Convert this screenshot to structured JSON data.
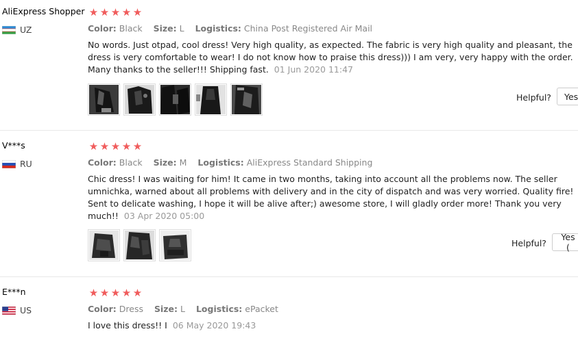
{
  "labels": {
    "color": "Color:",
    "size": "Size:",
    "logistics": "Logistics:",
    "helpful": "Helpful?",
    "yes": "Yes"
  },
  "reviews": [
    {
      "user": "AliExpress Shopper",
      "country": "UZ",
      "stars": 5,
      "color": "Black",
      "size": "L",
      "logistics": "China Post Registered Air Mail",
      "text": "No words. Just otpad, cool dress! Very high quality, as expected. The fabric is very high quality and pleasant, the dress is very comfortable to wear! I do not know how to praise this dress))) I am very, very happy with the order. Many thanks to the seller!!! Shipping fast.",
      "date": "01 Jun 2020 11:47",
      "photos": [
        "review-photo",
        "review-photo",
        "review-photo",
        "review-photo",
        "review-photo"
      ],
      "yes_label": "Yes"
    },
    {
      "user": "V***s",
      "country": "RU",
      "stars": 5,
      "color": "Black",
      "size": "M",
      "logistics": "AliExpress Standard Shipping",
      "text": "Chic dress! I was waiting for him! It came in two months, taking into account all the problems now. The seller umnichka, warned about all problems with delivery and in the city of dispatch and was very worried. Quality fire! Sent to delicate washing, I hope it will be alive after;) awesome store, I will gladly order more! Thank you very much!!",
      "date": "03 Apr 2020 05:00",
      "photos": [
        "review-photo",
        "review-photo",
        "review-photo"
      ],
      "yes_label": "Yes ("
    },
    {
      "user": "E***n",
      "country": "US",
      "stars": 5,
      "color": "Dress",
      "size": "L",
      "logistics": "ePacket",
      "text": "I love this dress!! I",
      "date": "06 May 2020 19:43",
      "photos": []
    }
  ]
}
